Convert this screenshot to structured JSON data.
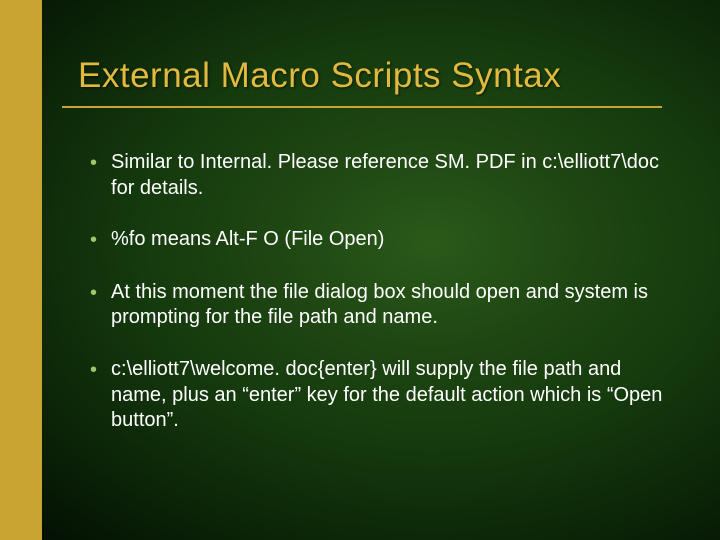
{
  "title": "External Macro Scripts Syntax",
  "bullets": [
    "Similar to Internal.  Please reference SM. PDF in c:\\elliott7\\doc for details.",
    "%fo means Alt-F O (File Open)",
    "At this moment the file dialog box should open and system is prompting for the file path and name.",
    "c:\\elliott7\\welcome. doc{enter} will supply the file path and name, plus an “enter” key for the default action which is “Open button”."
  ]
}
